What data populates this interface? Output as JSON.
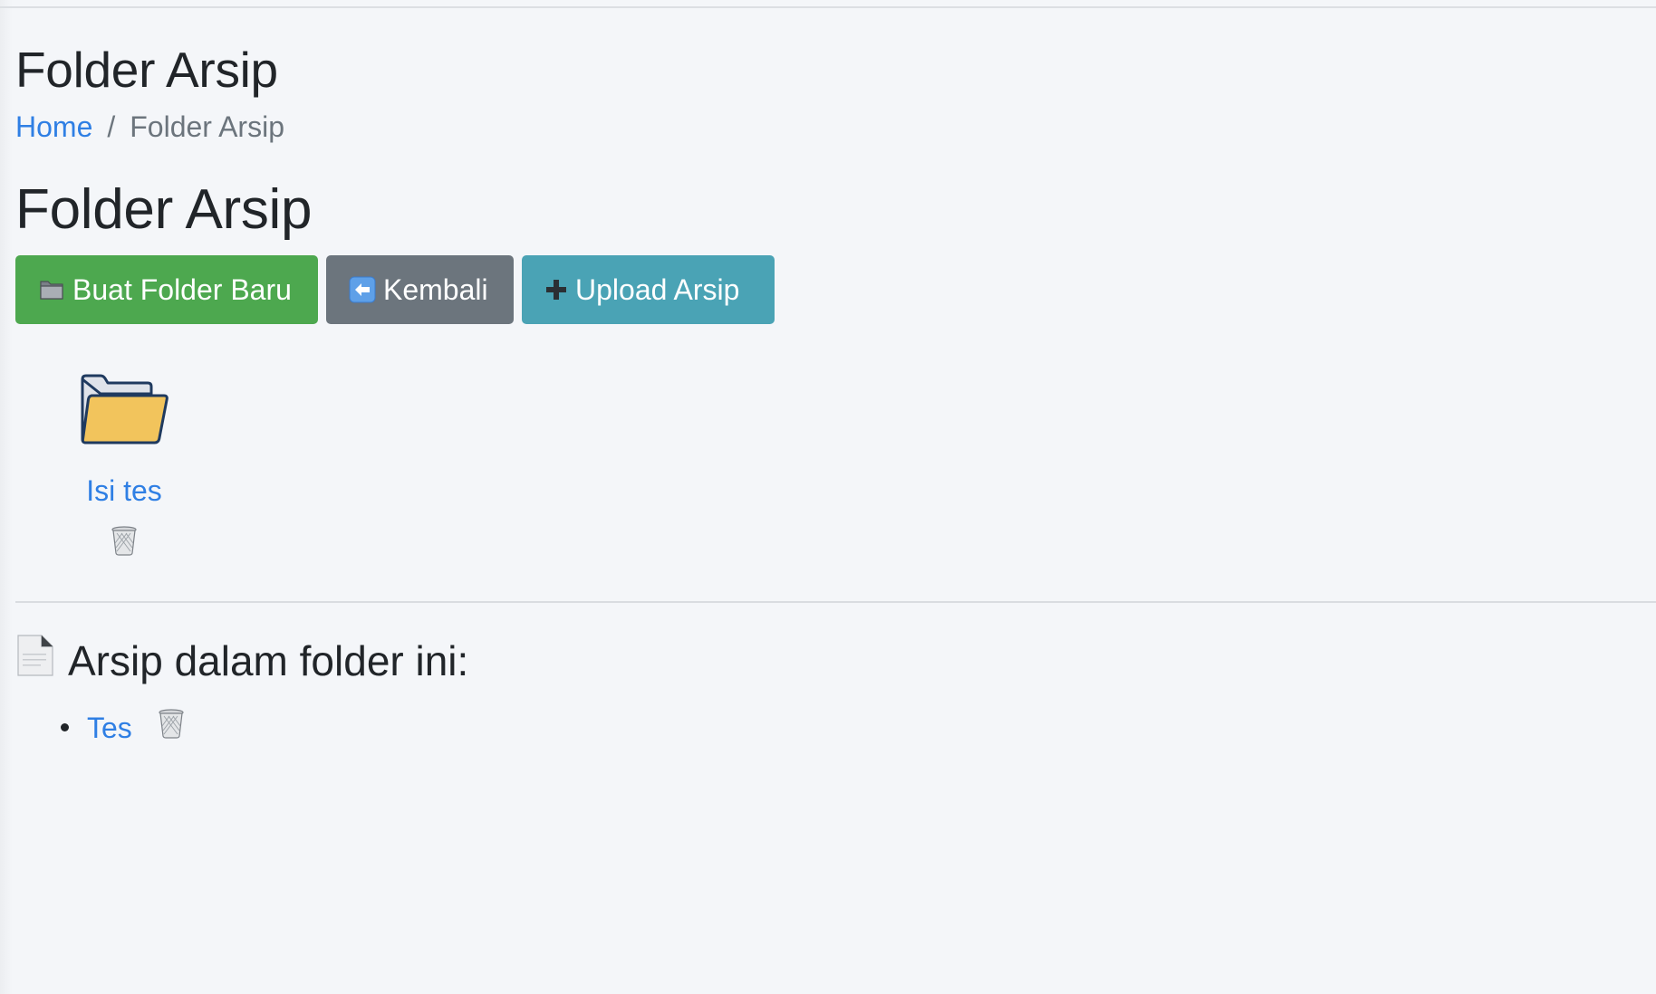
{
  "header": {
    "page_title": "Folder Arsip",
    "breadcrumb": {
      "home_label": "Home",
      "separator": "/",
      "current_label": "Folder Arsip"
    }
  },
  "main": {
    "section_title": "Folder Arsip",
    "toolbar": {
      "new_folder_label": "Buat Folder Baru",
      "new_folder_icon": "folder-icon",
      "back_label": "Kembali",
      "back_icon": "left-arrow-icon",
      "upload_label": "Upload Arsip",
      "upload_icon": "plus-icon"
    },
    "folders": [
      {
        "name": "Isi tes",
        "icon": "open-folder-icon",
        "delete_icon": "trash-icon"
      }
    ],
    "files_section": {
      "heading": "Arsip dalam folder ini:",
      "heading_icon": "document-icon",
      "files": [
        {
          "name": "Tes",
          "delete_icon": "trash-icon"
        }
      ]
    }
  },
  "colors": {
    "background": "#f4f6f9",
    "link": "#2f7fe4",
    "success": "#4da84f",
    "secondary": "#6c757d",
    "info": "#4aa3b5"
  }
}
